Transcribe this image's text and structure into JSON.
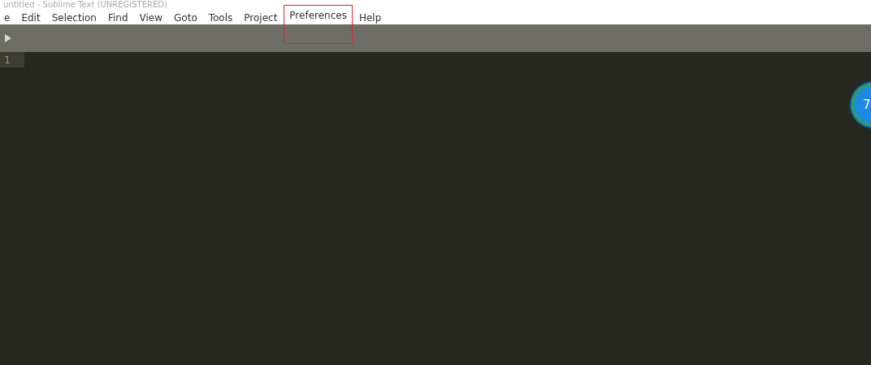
{
  "window": {
    "title": "untitled - Sublime Text (UNREGISTERED)"
  },
  "menu": [
    {
      "label": "e",
      "highlighted": false
    },
    {
      "label": "Edit",
      "highlighted": false
    },
    {
      "label": "Selection",
      "highlighted": false
    },
    {
      "label": "Find",
      "highlighted": false
    },
    {
      "label": "View",
      "highlighted": false
    },
    {
      "label": "Goto",
      "highlighted": false
    },
    {
      "label": "Tools",
      "highlighted": false
    },
    {
      "label": "Project",
      "highlighted": false
    },
    {
      "label": "Preferences",
      "highlighted": true
    },
    {
      "label": "Help",
      "highlighted": false
    }
  ],
  "editor": {
    "line_numbers": [
      "1"
    ]
  },
  "floating_badge": {
    "text": "7"
  }
}
